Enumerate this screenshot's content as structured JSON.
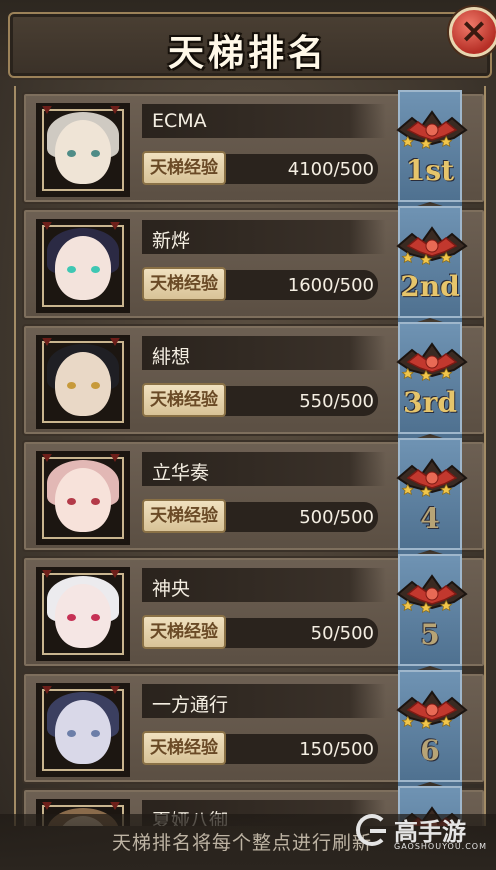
{
  "header": {
    "title": "天梯排名",
    "close_label": "×"
  },
  "exp_label": "天梯经验",
  "players": [
    {
      "name": "ECMA",
      "exp": "4100/500",
      "rank": "1st",
      "hair": "#cfcac2",
      "skin": "#efe4d6",
      "eye": "#4f8c87"
    },
    {
      "name": "新烨",
      "exp": "1600/500",
      "rank": "2nd",
      "hair": "#2b2a44",
      "skin": "#f3e3dc",
      "eye": "#3ec7b3"
    },
    {
      "name": "緋想",
      "exp": "550/500",
      "rank": "3rd",
      "hair": "#1f1f24",
      "skin": "#e9d8c6",
      "eye": "#c79a3b"
    },
    {
      "name": "立华奏",
      "exp": "500/500",
      "rank": "4",
      "hair": "#e2b8b5",
      "skin": "#f7e2da",
      "eye": "#b33a48"
    },
    {
      "name": "神央",
      "exp": "50/500",
      "rank": "5",
      "hair": "#ecebee",
      "skin": "#f5e6e4",
      "eye": "#c63155"
    },
    {
      "name": "一方通行",
      "exp": "150/500",
      "rank": "6",
      "hair": "#3b3f60",
      "skin": "#d9d8e8",
      "eye": "#6c7ea8"
    },
    {
      "name": "夏娅八御",
      "exp": "",
      "rank": "",
      "hair": "#8a6b4b",
      "skin": "#e8d2b4",
      "eye": "#6a4a26"
    }
  ],
  "footer": {
    "text": "天梯排名将每个整点进行刷新"
  },
  "watermark": {
    "main": "高手游",
    "sub": "GAOSHOUYOU.COM"
  }
}
